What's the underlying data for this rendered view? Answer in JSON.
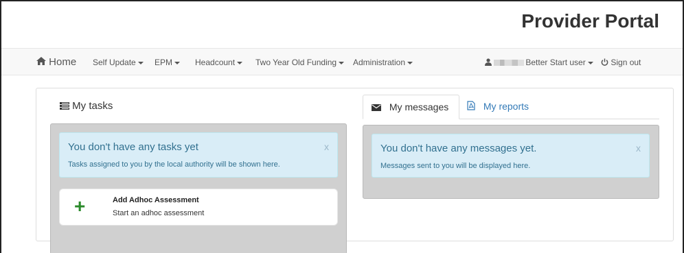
{
  "header": {
    "brand": "Provider Portal"
  },
  "nav": {
    "home": "Home",
    "self_update": "Self Update",
    "epm": "EPM",
    "headcount": "Headcount",
    "two_year": "Two Year Old Funding",
    "administration": "Administration",
    "user": "Better Start user",
    "sign_out": "Sign out"
  },
  "tasks": {
    "title": "My tasks",
    "alert_title": "You don't have any tasks yet",
    "alert_text": "Tasks assigned to you by the local authority will be shown here.",
    "close": "x",
    "adhoc_title": "Add Adhoc Assessment",
    "adhoc_sub": "Start an adhoc assessment"
  },
  "messages": {
    "tab_messages": "My messages",
    "tab_reports": "My reports",
    "alert_title": "You don't have any messages yet.",
    "alert_text": "Messages sent to you will be displayed here.",
    "close": "x"
  },
  "colors": {
    "link": "#337ab7",
    "alert_bg": "#d9edf7",
    "alert_text": "#31708f",
    "plus": "#2b8a2b"
  }
}
